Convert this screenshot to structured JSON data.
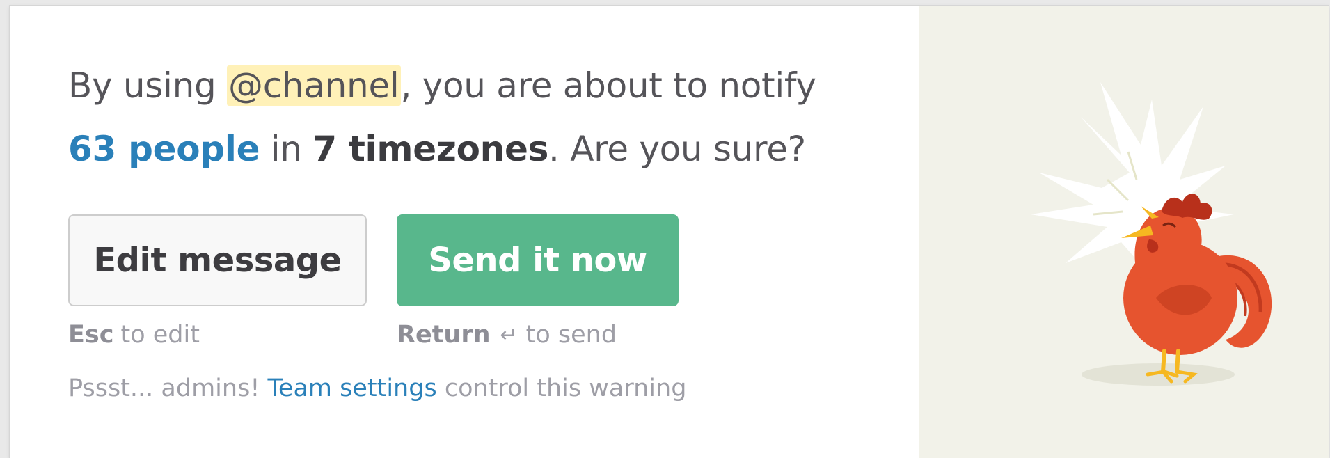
{
  "dialog": {
    "message": {
      "prefix": "By using ",
      "mention": "@channel",
      "middle": ", you are about to notify",
      "people": "63 people",
      "in": " in ",
      "timezones": "7 timezones",
      "suffix": ". Are you sure?"
    },
    "edit_button": {
      "label": "Edit message",
      "hint_key": "Esc",
      "hint_text": "to edit"
    },
    "send_button": {
      "label": "Send it now",
      "hint_key": "Return",
      "hint_icon": "enter-key-icon",
      "hint_text": "to send"
    },
    "footer": {
      "prefix": "Pssst... admins! ",
      "link": "Team settings",
      "suffix": " control this warning"
    },
    "illustration": "crowing-rooster-illustration"
  },
  "colors": {
    "accent_link": "#2a80b9",
    "send_button": "#58b78c",
    "mention_highlight": "#fff1b8",
    "rooster": "#e6542f",
    "illustration_bg": "#f2f2e9"
  }
}
